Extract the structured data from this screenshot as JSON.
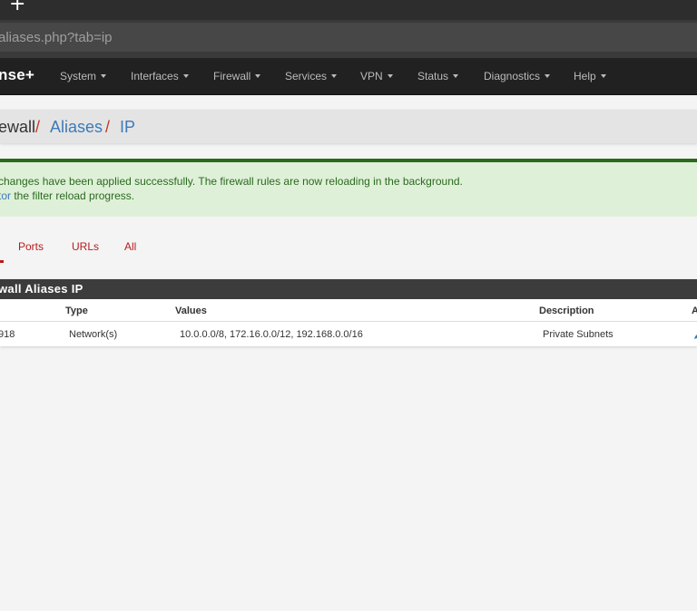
{
  "browser": {
    "new_tab_glyph": "+",
    "url": "aliases.php?tab=ip"
  },
  "navbar": {
    "brand": "nse",
    "brand_plus": "+",
    "items": [
      {
        "label": "System"
      },
      {
        "label": "Interfaces"
      },
      {
        "label": "Firewall"
      },
      {
        "label": "Services"
      },
      {
        "label": "VPN"
      },
      {
        "label": "Status"
      },
      {
        "label": "Diagnostics"
      },
      {
        "label": "Help"
      }
    ]
  },
  "breadcrumb": {
    "items": [
      "ewall",
      "Aliases",
      "IP"
    ],
    "separator": "/"
  },
  "alert": {
    "line1": "changes have been applied successfully. The firewall rules are now reloading in the background.",
    "line2_link": "tor",
    "line2_rest": " the filter reload progress."
  },
  "tabs": {
    "items": [
      {
        "label": "Ports"
      },
      {
        "label": "URLs"
      },
      {
        "label": "All"
      }
    ],
    "accent": "#b71c1c"
  },
  "panel": {
    "title": "wall Aliases IP",
    "columns": [
      "Type",
      "Values",
      "Description",
      "A"
    ],
    "rows": [
      {
        "name": "918",
        "type": "Network(s)",
        "values": "10.0.0.0/8, 172.16.0.0/12, 192.168.0.0/16",
        "description": "Private Subnets",
        "action_icon": "pencil-icon"
      }
    ]
  },
  "colors": {
    "navbar_bg": "#212121",
    "link_blue": "#3d7ab8",
    "alert_green": "#2a6a1f",
    "alert_bg": "#dff0d8",
    "tab_red": "#b71c1c"
  }
}
